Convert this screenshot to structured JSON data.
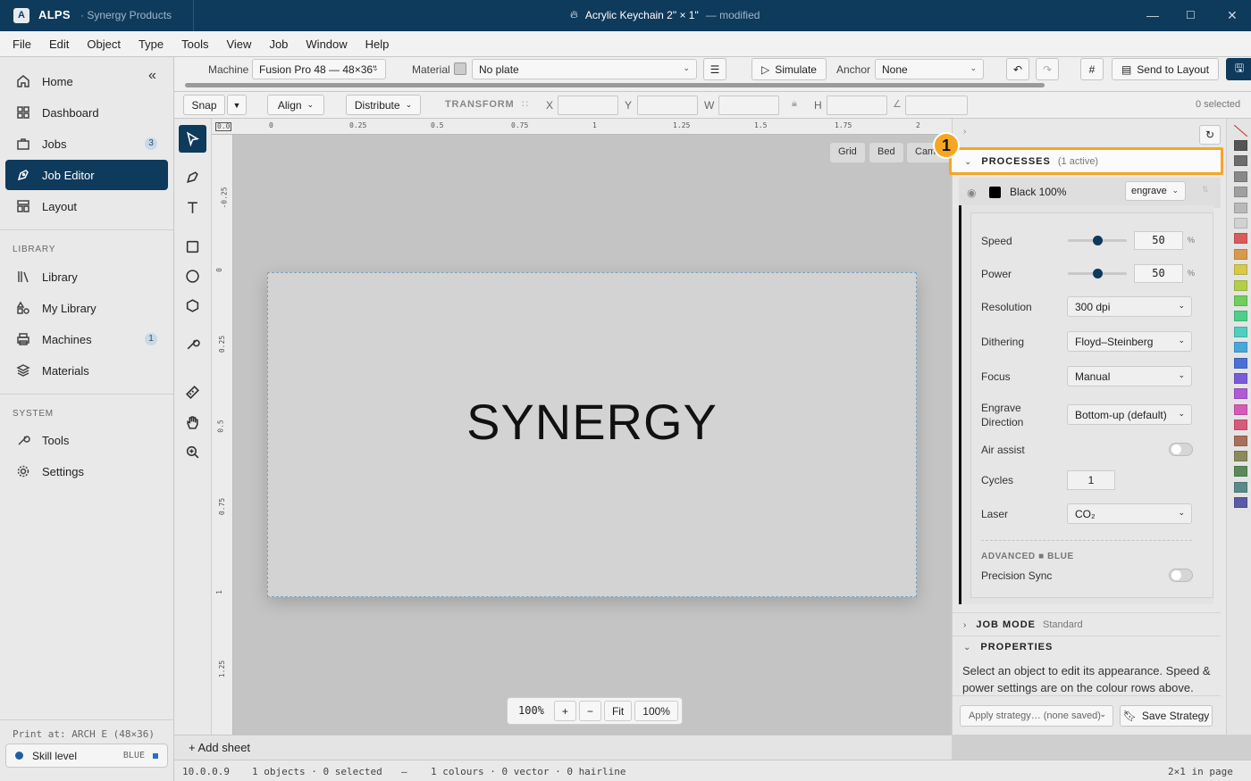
{
  "titlebar": {
    "logo": "A",
    "app": "ALPS",
    "org": "· Synergy Products",
    "document": "Acrylic Keychain 2\" × 1\"",
    "modified": "— modified"
  },
  "menu": [
    "File",
    "Edit",
    "Object",
    "Type",
    "Tools",
    "View",
    "Job",
    "Window",
    "Help"
  ],
  "sidebar": {
    "main": [
      {
        "label": "Home",
        "icon": "home-icon"
      },
      {
        "label": "Dashboard",
        "icon": "dashboard-icon"
      },
      {
        "label": "Jobs",
        "icon": "briefcase-icon",
        "count": "3"
      },
      {
        "label": "Job Editor",
        "icon": "pen-nib-icon",
        "active": true
      },
      {
        "label": "Layout",
        "icon": "layout-icon"
      }
    ],
    "library_header": "LIBRARY",
    "library": [
      {
        "label": "Library",
        "icon": "books-icon"
      },
      {
        "label": "My Library",
        "icon": "shapes-icon"
      },
      {
        "label": "Machines",
        "icon": "printer-icon",
        "count": "1"
      },
      {
        "label": "Materials",
        "icon": "layers-icon"
      }
    ],
    "system_header": "SYSTEM",
    "system": [
      {
        "label": "Tools",
        "icon": "wrench-icon"
      },
      {
        "label": "Settings",
        "icon": "gear-icon"
      }
    ],
    "print_at": "Print at: ARCH E (48×36)",
    "skill_label": "Skill level",
    "skill_value": "BLUE"
  },
  "toolbar": {
    "machine_label": "Machine",
    "machine_value": "Fusion Pro 48 — 48×36\"",
    "material_label": "Material",
    "material_value": "No plate",
    "simulate": "Simulate",
    "anchor_label": "Anchor",
    "anchor_value": "None",
    "send": "Send to Layout"
  },
  "toolbar2": {
    "snap": "Snap",
    "align": "Align",
    "distribute": "Distribute",
    "transform": "TRANSFORM",
    "x": "X",
    "y": "Y",
    "w": "W",
    "h": "H",
    "selected": "0 selected"
  },
  "ruler": {
    "h_ticks": [
      "0.0",
      "0",
      "0.25",
      "0.5",
      "0.75",
      "1",
      "1.25",
      "1.5",
      "1.75",
      "2"
    ],
    "v_ticks": [
      "-0.25",
      "0",
      "0.25",
      "0.5",
      "0.75",
      "1",
      "1.25"
    ]
  },
  "canvas": {
    "text": "SYNERGY",
    "view_buttons": [
      "Grid",
      "Bed",
      "Cam"
    ]
  },
  "zoom": {
    "value": "100%",
    "plus": "+",
    "minus": "−",
    "fit": "Fit",
    "reset": "100%"
  },
  "sheets": {
    "add": "+ Add sheet"
  },
  "status": {
    "version": "10.0.0.9",
    "objects": "1 objects · 0 selected",
    "dash": "—",
    "colours": "1 colours · 0 vector · 0 hairline",
    "pages": "2×1 in page"
  },
  "panel": {
    "processes": "PROCESSES",
    "processes_sub": "(1 active)",
    "row_label": "Black 100%",
    "row_mode": "engrave",
    "row_color": "#000000",
    "speed_label": "Speed",
    "speed": "50",
    "speed_level": 0.5,
    "power_label": "Power",
    "power": "50",
    "power_level": 0.5,
    "pct": "%",
    "resolution_label": "Resolution",
    "resolution": "300 dpi",
    "dithering_label": "Dithering",
    "dithering": "Floyd–Steinberg",
    "focus_label": "Focus",
    "focus": "Manual",
    "direction_label1": "Engrave",
    "direction_label2": "Direction",
    "direction": "Bottom-up (default)",
    "air_label": "Air assist",
    "cycles_label": "Cycles",
    "cycles": "1",
    "laser_label": "Laser",
    "laser": "CO₂",
    "advanced": "ADVANCED ■ BLUE",
    "precision": "Precision Sync",
    "job_mode": "JOB MODE",
    "job_mode_sub": "Standard",
    "properties": "PROPERTIES",
    "properties_text": "Select an object to edit its appearance. Speed & power settings are on the colour rows above.",
    "strategy": "Apply strategy… (none saved)",
    "save_strategy": "Save Strategy"
  },
  "callout": "1",
  "swatch_colors": [
    "#555555",
    "#6d6d6d",
    "#888888",
    "#a0a0a0",
    "#b9b9b9",
    "#d2d2d2",
    "#d95b5b",
    "#d89a4a",
    "#d7c94a",
    "#b3cf4a",
    "#6fcf5a",
    "#4fcf8a",
    "#4fcfc0",
    "#4aa8d8",
    "#4a6fd8",
    "#7a5ad8",
    "#b05ad8",
    "#d85ab8",
    "#d85a7a",
    "#a8705a",
    "#8a8a5a",
    "#5a8a5a",
    "#5a8a8a",
    "#5a5aa8"
  ]
}
